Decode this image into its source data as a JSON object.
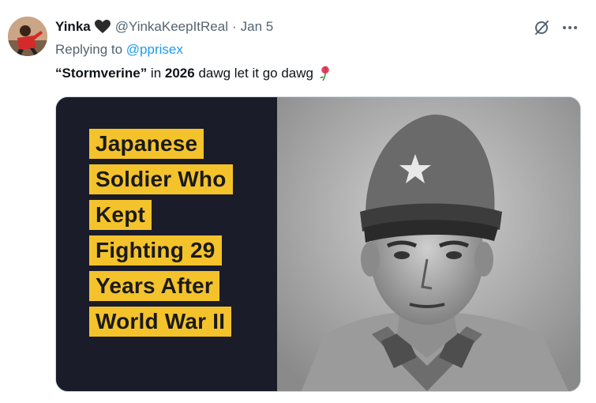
{
  "tweet": {
    "author_name": "Yinka",
    "handle": "@YinkaKeepItReal",
    "separator": "·",
    "date": "Jan 5",
    "replying_prefix": "Replying to",
    "replying_to": "@pprisex",
    "text": {
      "bold_quote": "“Stormverine”",
      "part2": " in ",
      "bold_year": "2026",
      "part3": " dawg let it go dawg"
    },
    "media_caption_lines": [
      "Japanese",
      "Soldier Who",
      "Kept",
      "Fighting 29",
      "Years After",
      "World War II"
    ]
  },
  "icons": {
    "verified_heart": "black-heart-icon",
    "grok": "grok-icon",
    "more": "more-icon",
    "emoji": "wilted-rose-icon"
  },
  "colors": {
    "link": "#1d9bf0",
    "secondary_text": "#536471",
    "caption_highlight": "#f4c32c",
    "media_dark": "#1b1c2a"
  }
}
